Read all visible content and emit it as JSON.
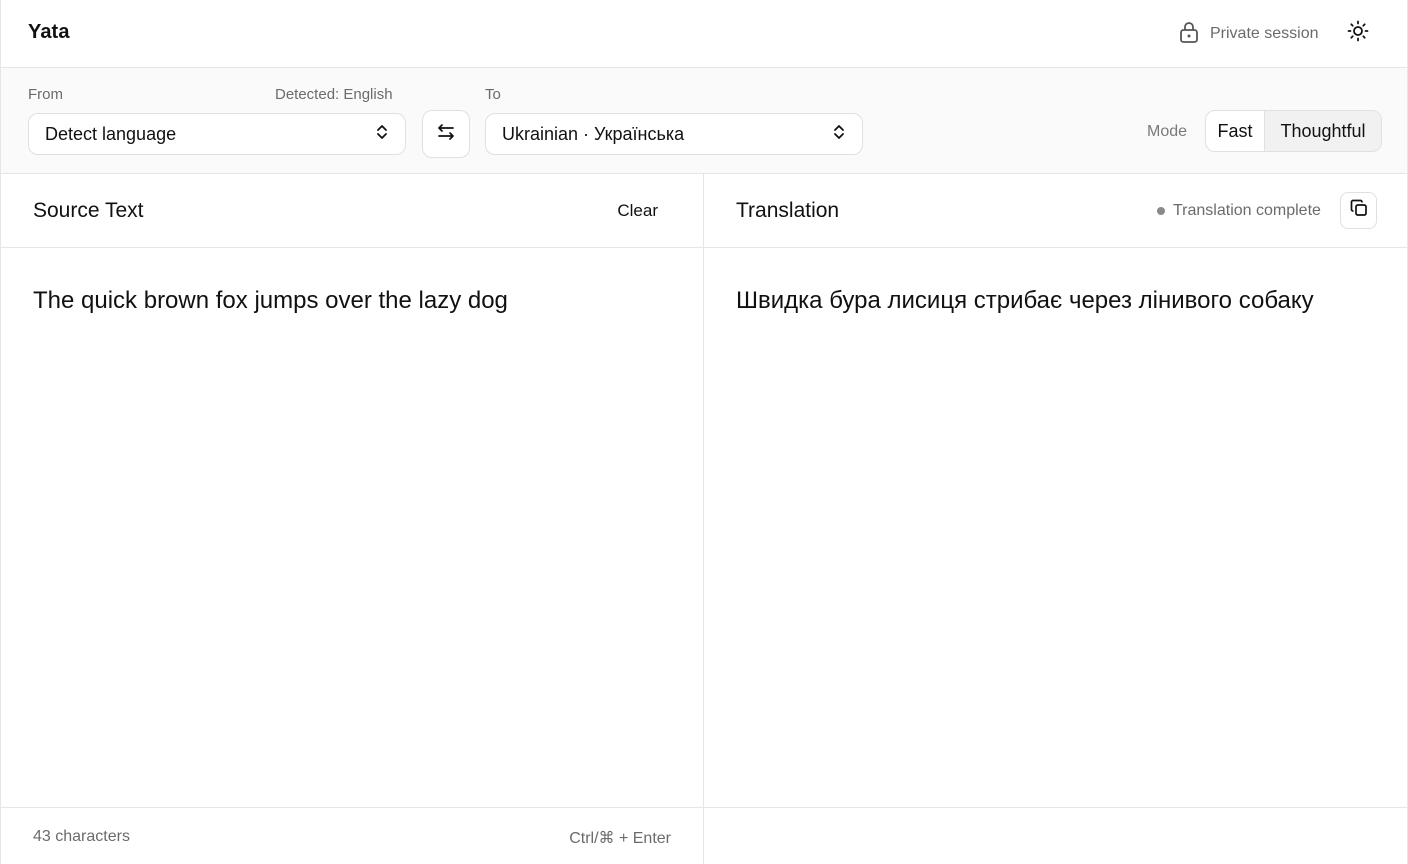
{
  "header": {
    "app_name": "Yata",
    "private_session_label": "Private session",
    "private_icon": "lock-icon",
    "theme_icon": "sun-icon"
  },
  "toolbar": {
    "from_label": "From",
    "detected_label": "Detected: English",
    "from_value": "Detect language",
    "swap_icon": "swap-arrows-icon",
    "to_label": "To",
    "to_value": "Ukrainian · Українська",
    "mode_label": "Mode",
    "modes": [
      "Fast",
      "Thoughtful"
    ],
    "selected_mode": "Thoughtful"
  },
  "source": {
    "title": "Source Text",
    "clear_label": "Clear",
    "text": "The quick brown fox jumps over the lazy dog",
    "char_count": "43 characters",
    "shortcut": "Ctrl/⌘ + Enter"
  },
  "translation": {
    "title": "Translation",
    "status": "Translation complete",
    "copy_icon": "copy-icon",
    "text": "Швидка бура лисиця стрибає через лінивого собаку"
  },
  "colors": {
    "border": "#e6e6e6",
    "muted_text": "#6b6b6b",
    "toolbar_bg": "#fafafa",
    "selected_segment_bg": "#f1f1f1"
  }
}
